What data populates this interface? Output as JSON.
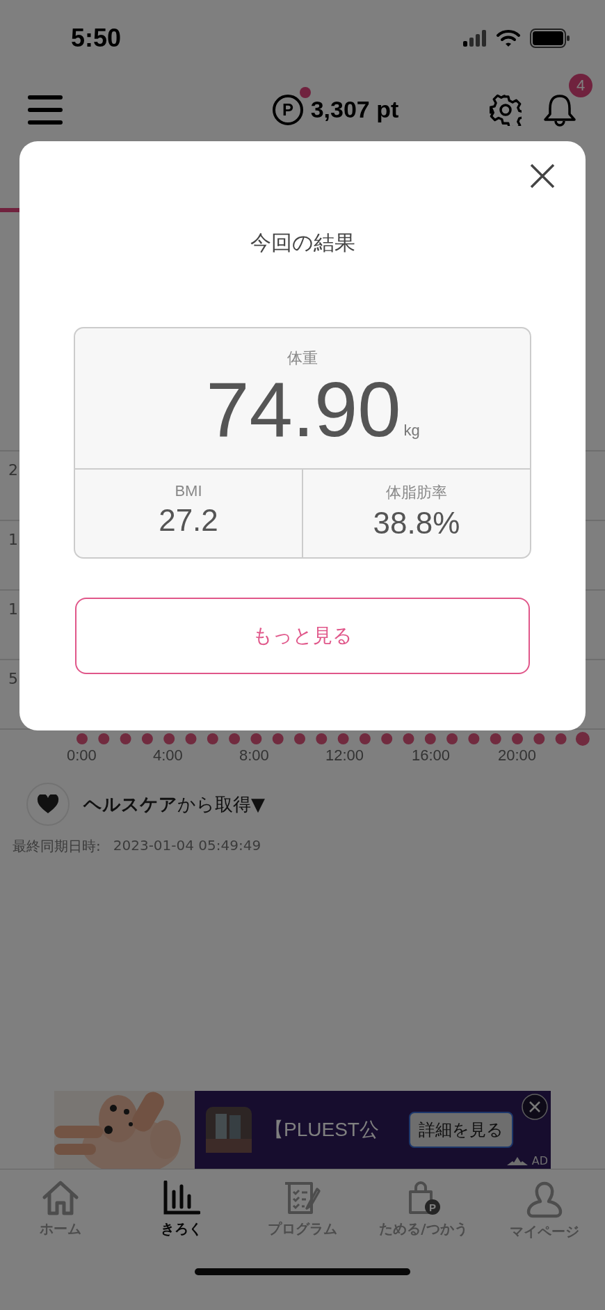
{
  "status_bar": {
    "time": "5:50"
  },
  "header": {
    "points_symbol": "P",
    "points": "3,307 pt",
    "points_notice": true,
    "notification_count": "4"
  },
  "chart": {
    "y_labels": [
      "2",
      "1",
      "1",
      "5"
    ],
    "x_labels": [
      "0:00",
      "4:00",
      "8:00",
      "12:00",
      "16:00",
      "20:00"
    ]
  },
  "sync": {
    "source": "**ヘルスケア**から取得▼",
    "last_sync_label": "最終同期日時:",
    "last_sync_time": "2023-01-04 05:49:49"
  },
  "ad": {
    "title": "【PLUEST公",
    "button": "詳細を見る",
    "label": "AD"
  },
  "tab_bar": [
    {
      "label": "ホーム",
      "kind": "home",
      "selected": false
    },
    {
      "label": "きろく",
      "kind": "record",
      "selected": true
    },
    {
      "label": "プログラム",
      "kind": "program",
      "selected": false
    },
    {
      "label": "ためる/つかう",
      "kind": "points",
      "icon_text": "P",
      "selected": false
    },
    {
      "label": "マイページ",
      "kind": "mypage",
      "selected": false
    }
  ],
  "modal": {
    "title": "今回の結果",
    "weight_label": "体重",
    "weight_value": "74.90",
    "weight_unit": "kg",
    "metrics": [
      {
        "label": "BMI",
        "value": "27.2"
      },
      {
        "label": "体脂肪率",
        "value": "38.8%"
      }
    ],
    "more_button": "もっと見る"
  }
}
